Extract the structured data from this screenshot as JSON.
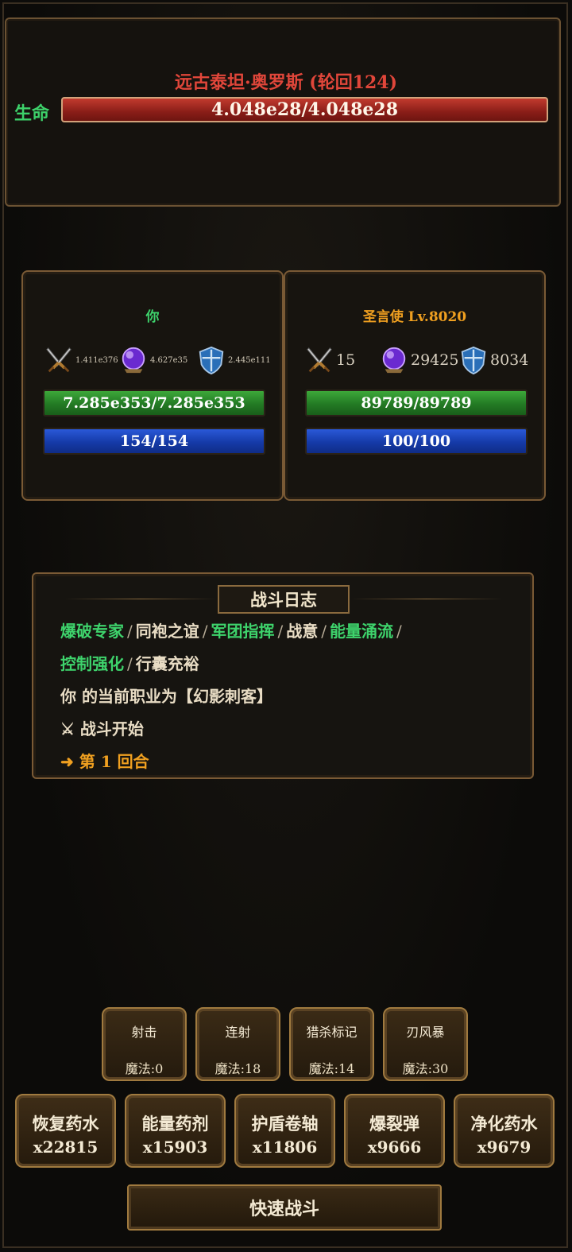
{
  "boss": {
    "name": "远古泰坦·奥罗斯 (轮回124)",
    "life_label": "生命",
    "hp_text": "4.048e28/4.048e28",
    "hp_fraction": 1.0
  },
  "player": {
    "name": "你",
    "attack": "1.411e376",
    "magic": "4.627e35",
    "defense": "2.445e111",
    "hp_text": "7.285e353/7.285e353",
    "mp_text": "154/154"
  },
  "companion": {
    "name": "圣言使 Lv.8020",
    "attack": "15",
    "magic": "29425",
    "defense": "8034",
    "hp_text": "89789/89789",
    "mp_text": "100/100"
  },
  "log": {
    "title": "战斗日志",
    "buffs_line1": [
      "爆破专家",
      "同袍之谊",
      "军团指挥",
      "战意",
      "能量涌流"
    ],
    "buffs_line2": [
      "控制强化",
      "行囊充裕"
    ],
    "separator": "/",
    "class_line": "你 的当前职业为【幻影刺客】",
    "battle_start": "⚔ 战斗开始",
    "round_arrow": "➜",
    "round_text": "第 1 回合"
  },
  "skills": [
    {
      "name": "射击",
      "cost": "魔法:0"
    },
    {
      "name": "连射",
      "cost": "魔法:18"
    },
    {
      "name": "猎杀标记",
      "cost": "魔法:14"
    },
    {
      "name": "刃风暴",
      "cost": "魔法:30"
    }
  ],
  "items": [
    {
      "name": "恢复药水",
      "count": "x22815"
    },
    {
      "name": "能量药剂",
      "count": "x15903"
    },
    {
      "name": "护盾卷轴",
      "count": "x11806"
    },
    {
      "name": "爆裂弹",
      "count": "x9666"
    },
    {
      "name": "净化药水",
      "count": "x9679"
    }
  ],
  "quick_battle_label": "快速战斗",
  "icons": {
    "attack": "crossed-swords-icon",
    "magic": "purple-orb-icon",
    "defense": "blue-shield-icon"
  },
  "colors": {
    "boss_name": "#e0463a",
    "buff_highlight": "#3ed36c",
    "companion_name": "#f0a020",
    "hp_bar": "#237a24",
    "mp_bar": "#153aa8",
    "boss_hp_bar": "#8a1e18"
  }
}
